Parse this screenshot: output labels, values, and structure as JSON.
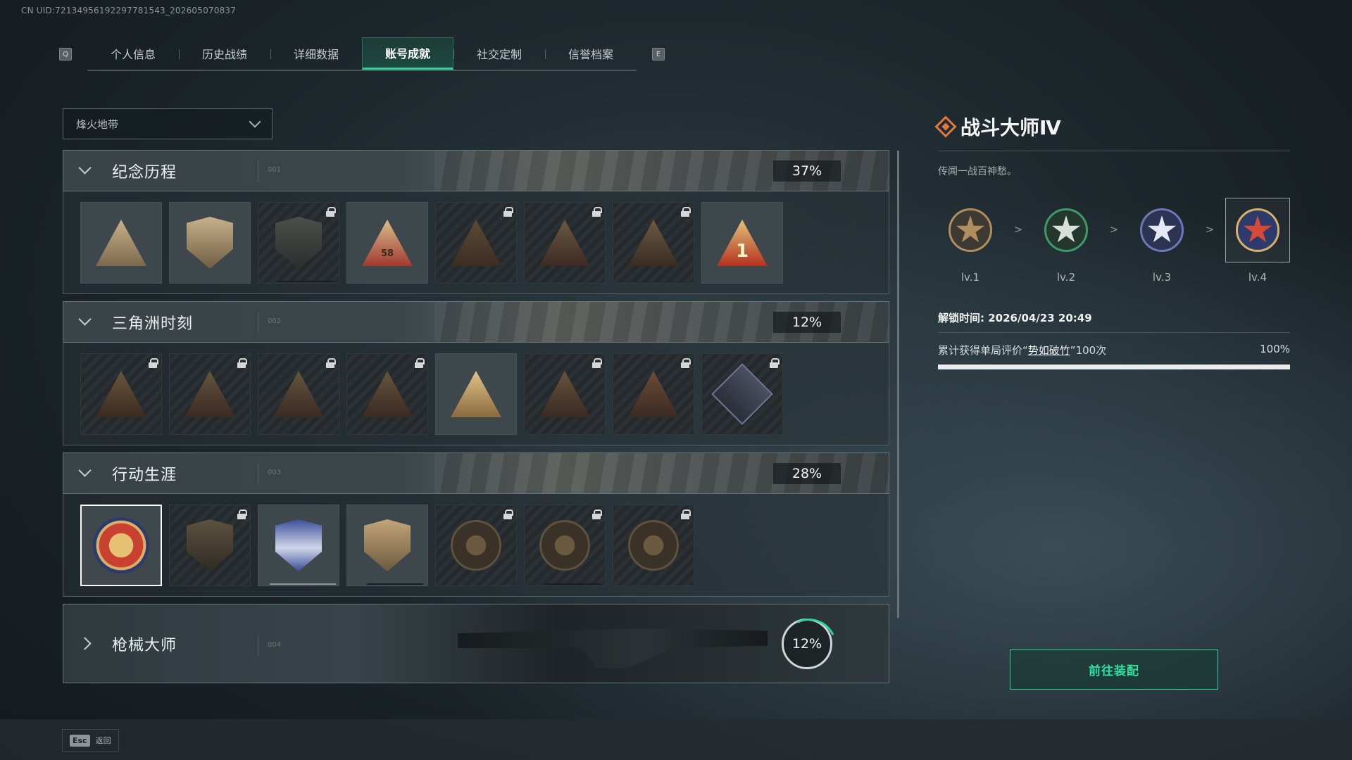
{
  "uid": "CN UID:7213495619229778154​3_202605070837",
  "tabs": {
    "left_key": "Q",
    "right_key": "E",
    "items": [
      "个人信息",
      "历史战绩",
      "详细数据",
      "账号成就",
      "社交定制",
      "信誉档案"
    ],
    "active": "账号成就"
  },
  "filter": {
    "selected": "烽火地带"
  },
  "categories": [
    {
      "title": "纪念历程",
      "code": "001",
      "percent": "37%",
      "expanded": true
    },
    {
      "title": "三角洲时刻",
      "code": "002",
      "percent": "12%",
      "expanded": true
    },
    {
      "title": "行动生涯",
      "code": "003",
      "percent": "28%",
      "expanded": true
    },
    {
      "title": "枪械大师",
      "code": "004",
      "percent": "12%",
      "expanded": false,
      "progress": 0.12
    }
  ],
  "badge_text": {
    "b58": "58",
    "b1": "1"
  },
  "detail": {
    "title": "战斗大师Ⅳ",
    "description": "传闻一战百神愁。",
    "levels": [
      "lv.1",
      "lv.2",
      "lv.3",
      "lv.4"
    ],
    "arrow": ">",
    "unlock_time": "解锁时间: 2026/04/23 20:49",
    "req_prefix": "累计获得单局评价“",
    "req_term": "势如破竹",
    "req_suffix": "”100次",
    "req_progress": "100%",
    "colors": {
      "lv1": "#b08e5e",
      "lv2": "#3f9a6b",
      "lv3": "#6d79b4",
      "lv4": "#d64a3a"
    }
  },
  "equip_button": "前往装配",
  "footer": {
    "key": "Esc",
    "label": "返回"
  },
  "accent": "#2fd39a"
}
